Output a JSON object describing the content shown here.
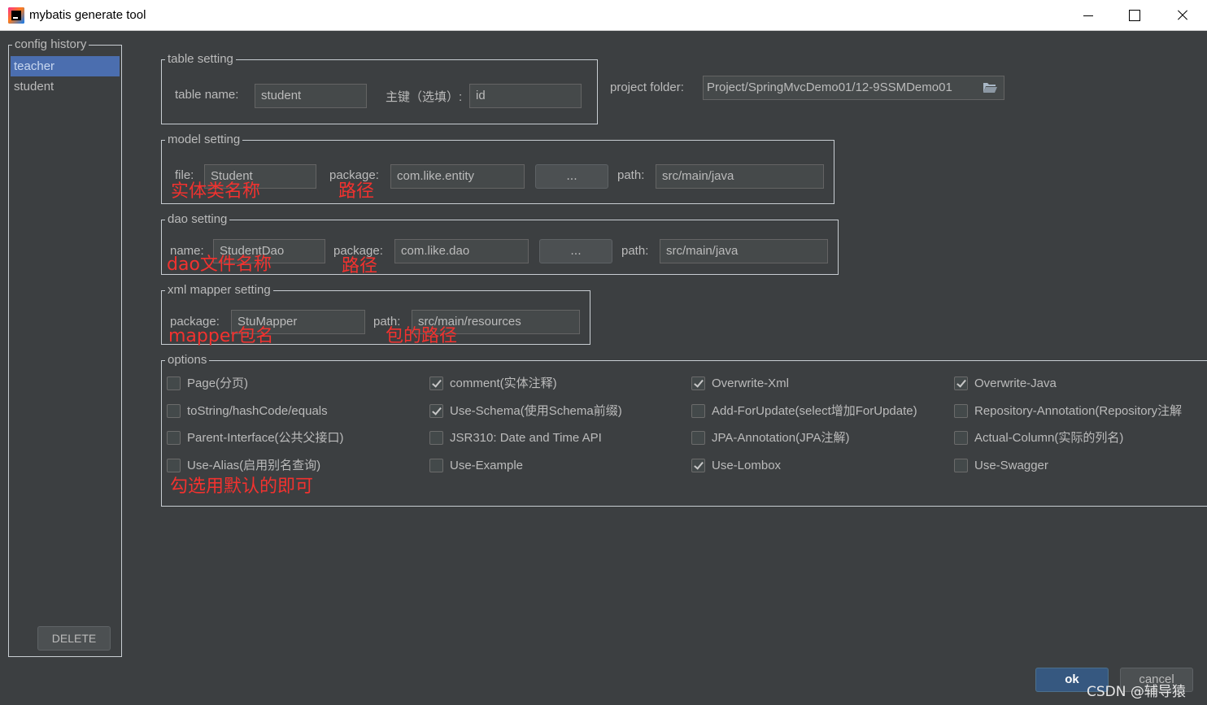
{
  "window": {
    "title": "mybatis generate tool"
  },
  "history": {
    "legend": "config history",
    "items": [
      {
        "label": "teacher",
        "selected": true
      },
      {
        "label": "student",
        "selected": false
      }
    ],
    "delete_label": "DELETE"
  },
  "table": {
    "legend": "table setting",
    "name_label": "table  name:",
    "name_value": "student",
    "pk_label": "主键（选填）:",
    "pk_value": "id"
  },
  "project": {
    "label": "project folder:",
    "value": "Project/SpringMvcDemo01/12-9SSMDemo01",
    "icon": "folder-open-icon"
  },
  "model": {
    "legend": "model setting",
    "file_label": "file:",
    "file_value": "Student",
    "package_label": "package:",
    "package_value": "com.like.entity",
    "browse_label": "...",
    "path_label": "path:",
    "path_value": "src/main/java",
    "anno_file": "实体类名称",
    "anno_package": "路径"
  },
  "dao": {
    "legend": "dao setting",
    "name_label": "name:",
    "name_value": "StudentDao",
    "package_label": "package:",
    "package_value": "com.like.dao",
    "browse_label": "...",
    "path_label": "path:",
    "path_value": "src/main/java",
    "anno_name": "dao文件名称",
    "anno_package": "路径"
  },
  "xml": {
    "legend": "xml mapper setting",
    "package_label": "package:",
    "package_value": "StuMapper",
    "path_label": "path:",
    "path_value": "src/main/resources",
    "anno_package": "mapper包名",
    "anno_path": "包的路径"
  },
  "options": {
    "legend": "options",
    "items": [
      {
        "label": "Page(分页)",
        "checked": false
      },
      {
        "label": "comment(实体注释)",
        "checked": true
      },
      {
        "label": "Overwrite-Xml",
        "checked": true
      },
      {
        "label": "Overwrite-Java",
        "checked": true
      },
      {
        "label": "toString/hashCode/equals",
        "checked": false
      },
      {
        "label": "Use-Schema(使用Schema前缀)",
        "checked": true
      },
      {
        "label": "Add-ForUpdate(select增加ForUpdate)",
        "checked": false
      },
      {
        "label": "Repository-Annotation(Repository注解",
        "checked": false
      },
      {
        "label": "Parent-Interface(公共父接口)",
        "checked": false
      },
      {
        "label": "JSR310: Date and Time API",
        "checked": false
      },
      {
        "label": "JPA-Annotation(JPA注解)",
        "checked": false
      },
      {
        "label": "Actual-Column(实际的列名)",
        "checked": false
      },
      {
        "label": "Use-Alias(启用别名查询)",
        "checked": false
      },
      {
        "label": "Use-Example",
        "checked": false
      },
      {
        "label": "Use-Lombox",
        "checked": true
      },
      {
        "label": "Use-Swagger",
        "checked": false
      }
    ],
    "anno": "勾选用默认的即可"
  },
  "buttons": {
    "ok": "ok",
    "cancel": "cancel"
  },
  "watermark": "CSDN @辅导猿",
  "colors": {
    "background": "#3c3f41",
    "selection": "#4b6eaf",
    "annotation": "#f2322f",
    "ok_button": "#365880"
  }
}
